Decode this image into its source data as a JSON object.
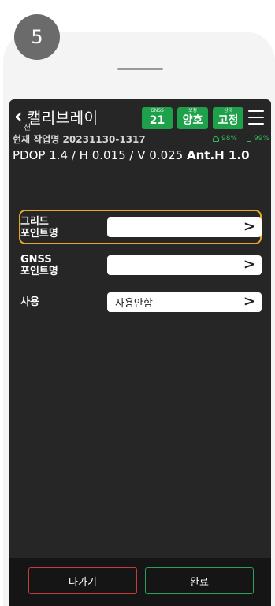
{
  "step": {
    "number": "5"
  },
  "header": {
    "back_icon": "chevron-left-icon",
    "title": "캘리브레이",
    "title_tail": "션",
    "badges": [
      {
        "caption": "GNSS",
        "value": "21"
      },
      {
        "caption": "보정",
        "value": "양호"
      },
      {
        "caption": "상태",
        "value": "고정"
      }
    ],
    "menu_icon": "hamburger-menu-icon",
    "badge_color": "#1ea14a"
  },
  "job": {
    "text": "현재 작업명 20231130-1317"
  },
  "status": {
    "wifi": "98%",
    "battery": "99%",
    "color": "#2fbb55"
  },
  "pdop": {
    "text": "PDOP 1.4 / H 0.015 / V 0.025",
    "ant": "Ant.H 1.0"
  },
  "form": {
    "rows": [
      {
        "label_line1": "그리드",
        "label_line2": "포인트명",
        "value": ""
      },
      {
        "label_line1": "GNSS",
        "label_line2": "포인트명",
        "value": ""
      },
      {
        "label_line1": "사용",
        "label_line2": "",
        "value": "사용안함"
      }
    ],
    "arrow": ">",
    "highlight_color": "#e4a928"
  },
  "footer": {
    "exit_label": "나가기",
    "done_label": "완료",
    "exit_color": "#c63b3b",
    "done_color": "#2aa05a"
  }
}
